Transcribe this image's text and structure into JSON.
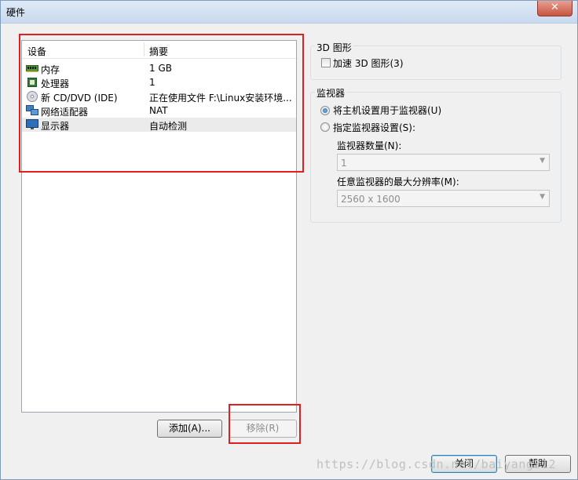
{
  "window": {
    "title": "硬件",
    "close_symbol": "✕"
  },
  "device_list": {
    "headers": {
      "device": "设备",
      "summary": "摘要"
    },
    "rows": [
      {
        "icon": "memory-icon",
        "name": "内存",
        "summary": "1 GB"
      },
      {
        "icon": "processor-icon",
        "name": "处理器",
        "summary": "1"
      },
      {
        "icon": "cd-dvd-icon",
        "name": "新 CD/DVD (IDE)",
        "summary": "正在使用文件 F:\\Linux安装环境..."
      },
      {
        "icon": "network-adapter-icon",
        "name": "网络适配器",
        "summary": "NAT"
      },
      {
        "icon": "display-icon",
        "name": "显示器",
        "summary": "自动检测",
        "selected": true
      }
    ]
  },
  "list_buttons": {
    "add": "添加(A)...",
    "remove": "移除(R)"
  },
  "graphics_3d": {
    "title": "3D 图形",
    "accelerate": "加速 3D 图形(3)",
    "accelerate_checked": false
  },
  "monitor": {
    "title": "监视器",
    "use_host": "将主机设置用于监视器(U)",
    "specify": "指定监视器设置(S):",
    "selected_option": "use_host",
    "count_label": "监视器数量(N):",
    "count_value": "1",
    "resolution_label": "任意监视器的最大分辨率(M):",
    "resolution_value": "2560 x 1600"
  },
  "footer": {
    "close": "关闭",
    "help": "帮助"
  },
  "watermark": "https://blog.csdn.net/baiyang212",
  "colors": {
    "highlight_box": "#e02020",
    "selected_row": "#ebebeb"
  }
}
